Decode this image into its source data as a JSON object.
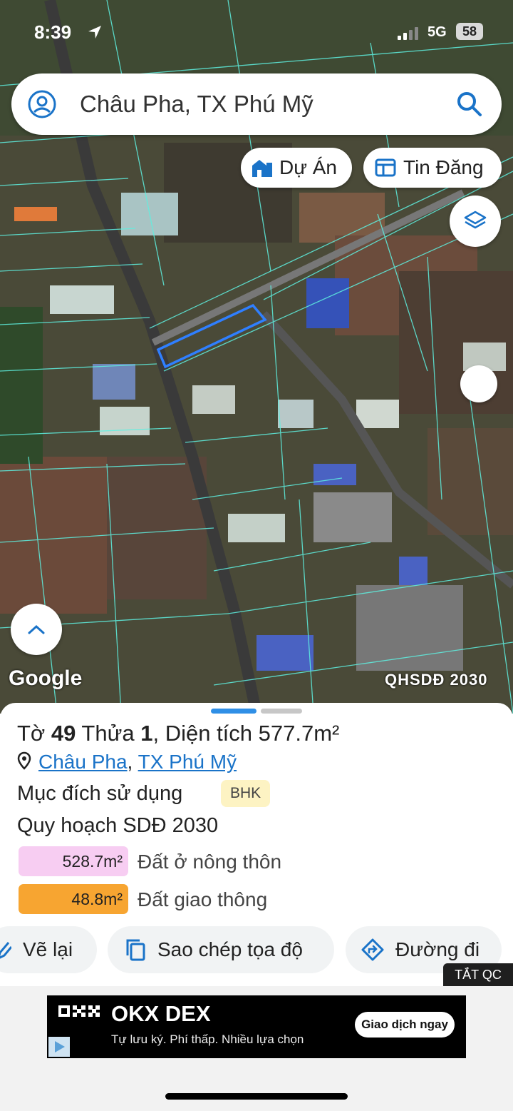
{
  "status_bar": {
    "time": "8:39",
    "network": "5G",
    "battery": "58"
  },
  "search": {
    "text": "Châu Pha, TX Phú Mỹ"
  },
  "chips": {
    "du_an": "Dự Án",
    "tin_dang": "Tin Đăng"
  },
  "map": {
    "google_label": "Google",
    "layer_label": "QHSDĐ 2030"
  },
  "parcel": {
    "prefix_to": "Tờ ",
    "to_number": "49",
    "thua_label": " Thửa ",
    "thua_number": "1",
    "area_label": ", Diện tích ",
    "area_value": "577.7m²",
    "commune": "Châu Pha",
    "separator": ", ",
    "town": "TX Phú Mỹ",
    "purpose_label": "Mục đích sử dụng",
    "purpose_code": "BHK",
    "plan_label": "Quy hoạch SDĐ 2030",
    "zones": [
      {
        "area": "528.7m²",
        "label": "Đất ở nông thôn",
        "color": "#f7cdf2"
      },
      {
        "area": "48.8m²",
        "label": "Đất giao thông",
        "color": "#f7a531"
      }
    ]
  },
  "actions": {
    "redraw": "Vẽ lại",
    "copy_coords": "Sao chép tọa độ",
    "directions": "Đường đi"
  },
  "ad": {
    "close_label": "TẮT QC",
    "brand": "OKX DEX",
    "tagline": "Tự lưu ký. Phí thấp. Nhiều lựa chọn",
    "cta": "Giao dịch ngay"
  },
  "colors": {
    "accent": "#1a73c8",
    "parcel_outline": "#2f7fff",
    "grid": "#5ef0e0"
  }
}
